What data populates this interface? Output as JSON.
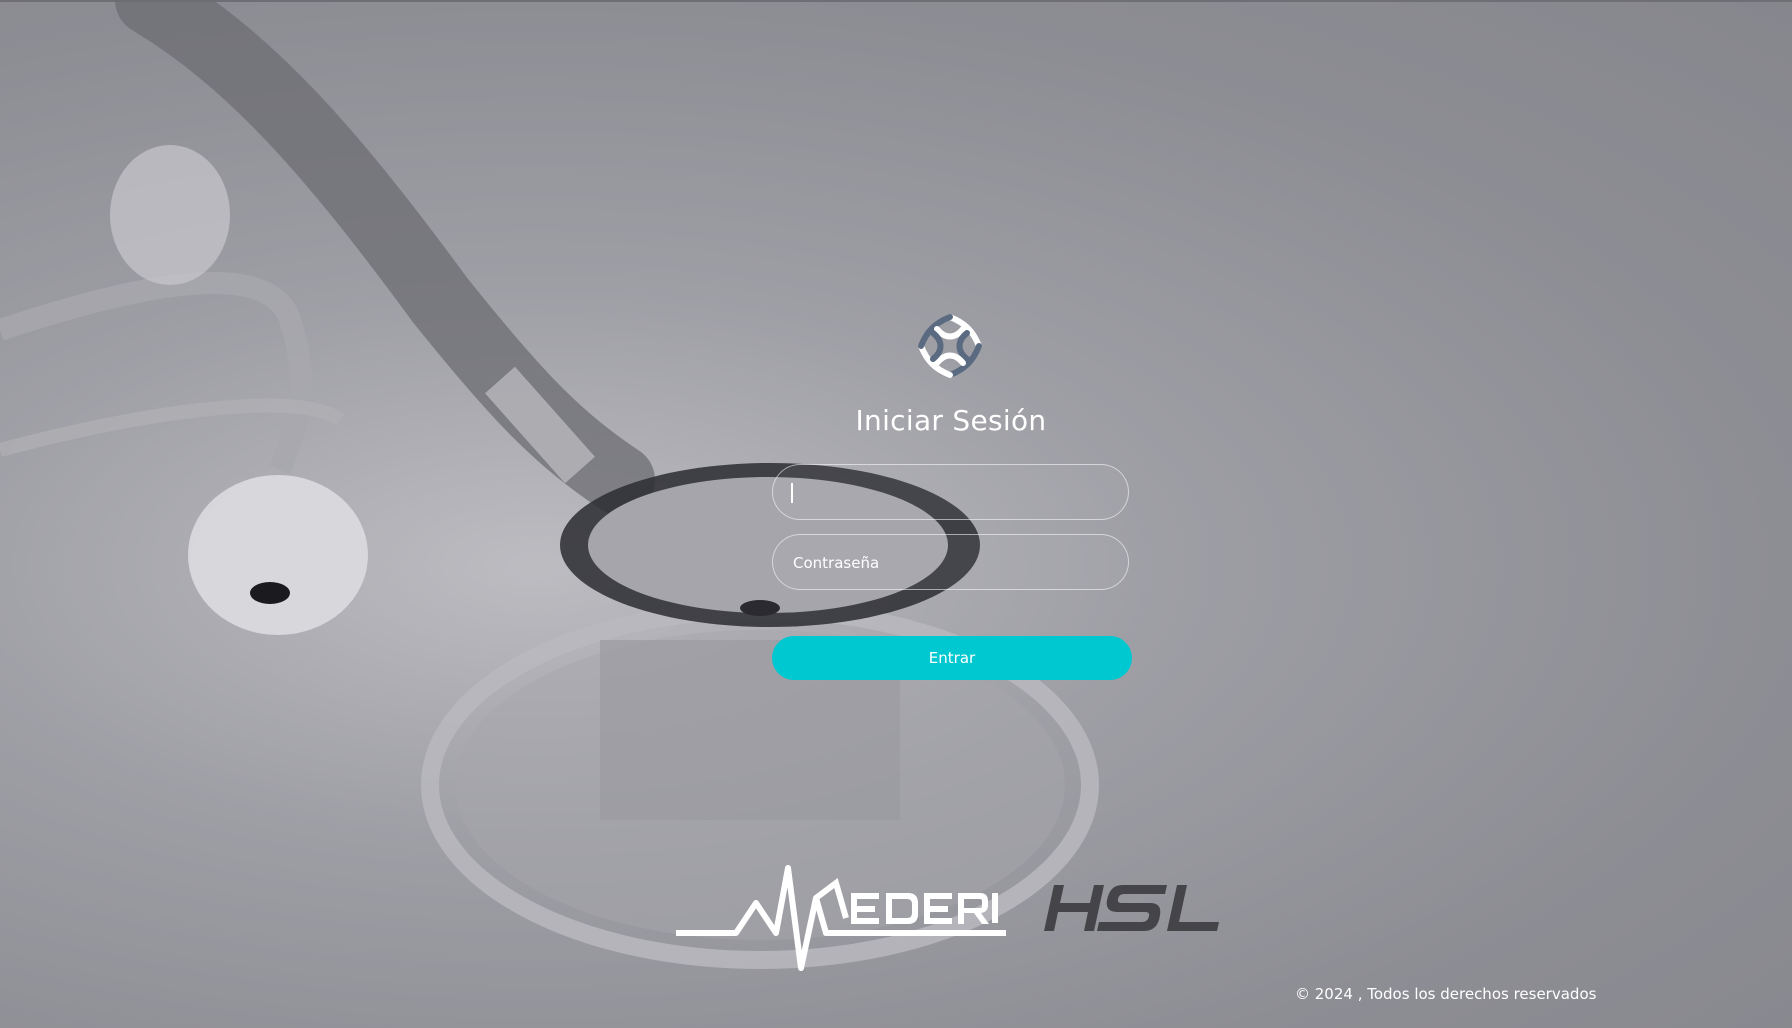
{
  "login": {
    "title": "Iniciar Sesión",
    "username_placeholder": "",
    "username_value": "",
    "password_placeholder": "Contraseña",
    "submit_label": "Entrar"
  },
  "brands": {
    "mederi": "MEDERI",
    "hsl": "HSL"
  },
  "footer": {
    "copyright": "© 2024 , Todos los derechos reservados"
  },
  "colors": {
    "accent": "#00c8d0",
    "text": "#ffffff",
    "background": "#8d8d94"
  },
  "icons": {
    "app_logo": "interlocking-rings-logo-icon"
  }
}
